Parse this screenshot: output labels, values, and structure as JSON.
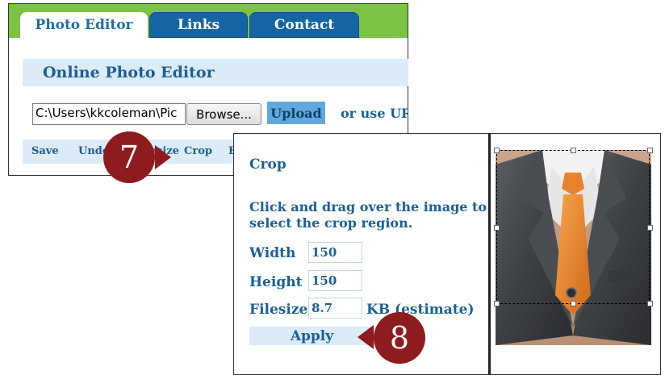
{
  "tabs": [
    {
      "label": "Photo Editor",
      "active": true
    },
    {
      "label": "Links",
      "active": false
    },
    {
      "label": "Contact",
      "active": false
    }
  ],
  "heading": "Online Photo Editor",
  "file_input": {
    "value": "C:\\Users\\kkcoleman\\Pic"
  },
  "browse_label": "Browse...",
  "upload_label": "Upload",
  "use_url_text": "or use URL",
  "toolbar": {
    "save": "Save",
    "undo": "Undo",
    "resize": "Resize",
    "crop": "Crop",
    "more": "E"
  },
  "steps": {
    "step7": "7",
    "step8": "8"
  },
  "crop_panel": {
    "title": "Crop",
    "instruction": "Click and drag over the image to select the crop region.",
    "width_label": "Width",
    "width_value": "150",
    "height_label": "Height",
    "height_value": "150",
    "filesize_label": "Filesize",
    "filesize_value": "8.7",
    "filesize_unit": "KB (estimate)",
    "apply_label": "Apply"
  },
  "colors": {
    "tab_bar_green": "#7cc243",
    "tab_blue": "#1565a4",
    "heading_text": "#1b5f95",
    "light_bar": "#dcebf8",
    "step_circle": "#8e1b1e"
  }
}
